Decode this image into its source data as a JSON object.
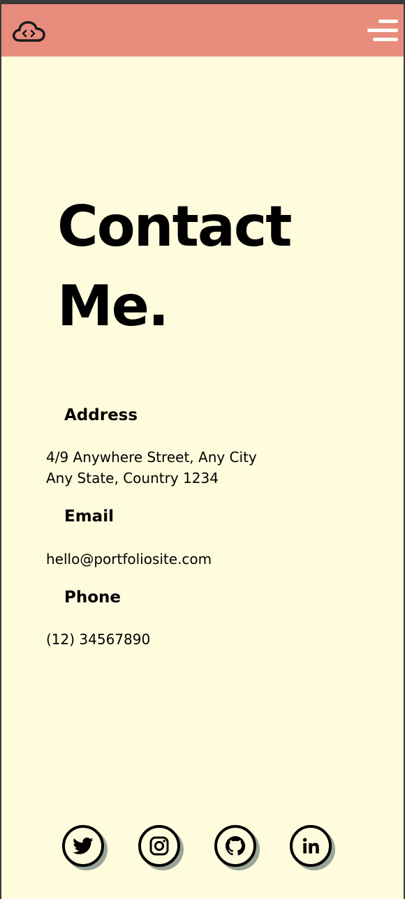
{
  "header": {
    "logo_icon": "cloud-code-icon",
    "menu_icon": "hamburger-menu-icon",
    "bar_color": "#e88c7d"
  },
  "page": {
    "title_line1": "Contact",
    "title_line2": "Me.",
    "background": "#fefcdc"
  },
  "contact": {
    "address_label": "Address",
    "address_line1": "4/9 Anywhere Street, Any City",
    "address_line2": "Any State, Country 1234",
    "email_label": "Email",
    "email": "hello@portfoliosite.com",
    "phone_label": "Phone",
    "phone": "(12) 34567890"
  },
  "social": [
    {
      "icon": "twitter-icon"
    },
    {
      "icon": "instagram-icon"
    },
    {
      "icon": "github-icon"
    },
    {
      "icon": "linkedin-icon"
    }
  ]
}
